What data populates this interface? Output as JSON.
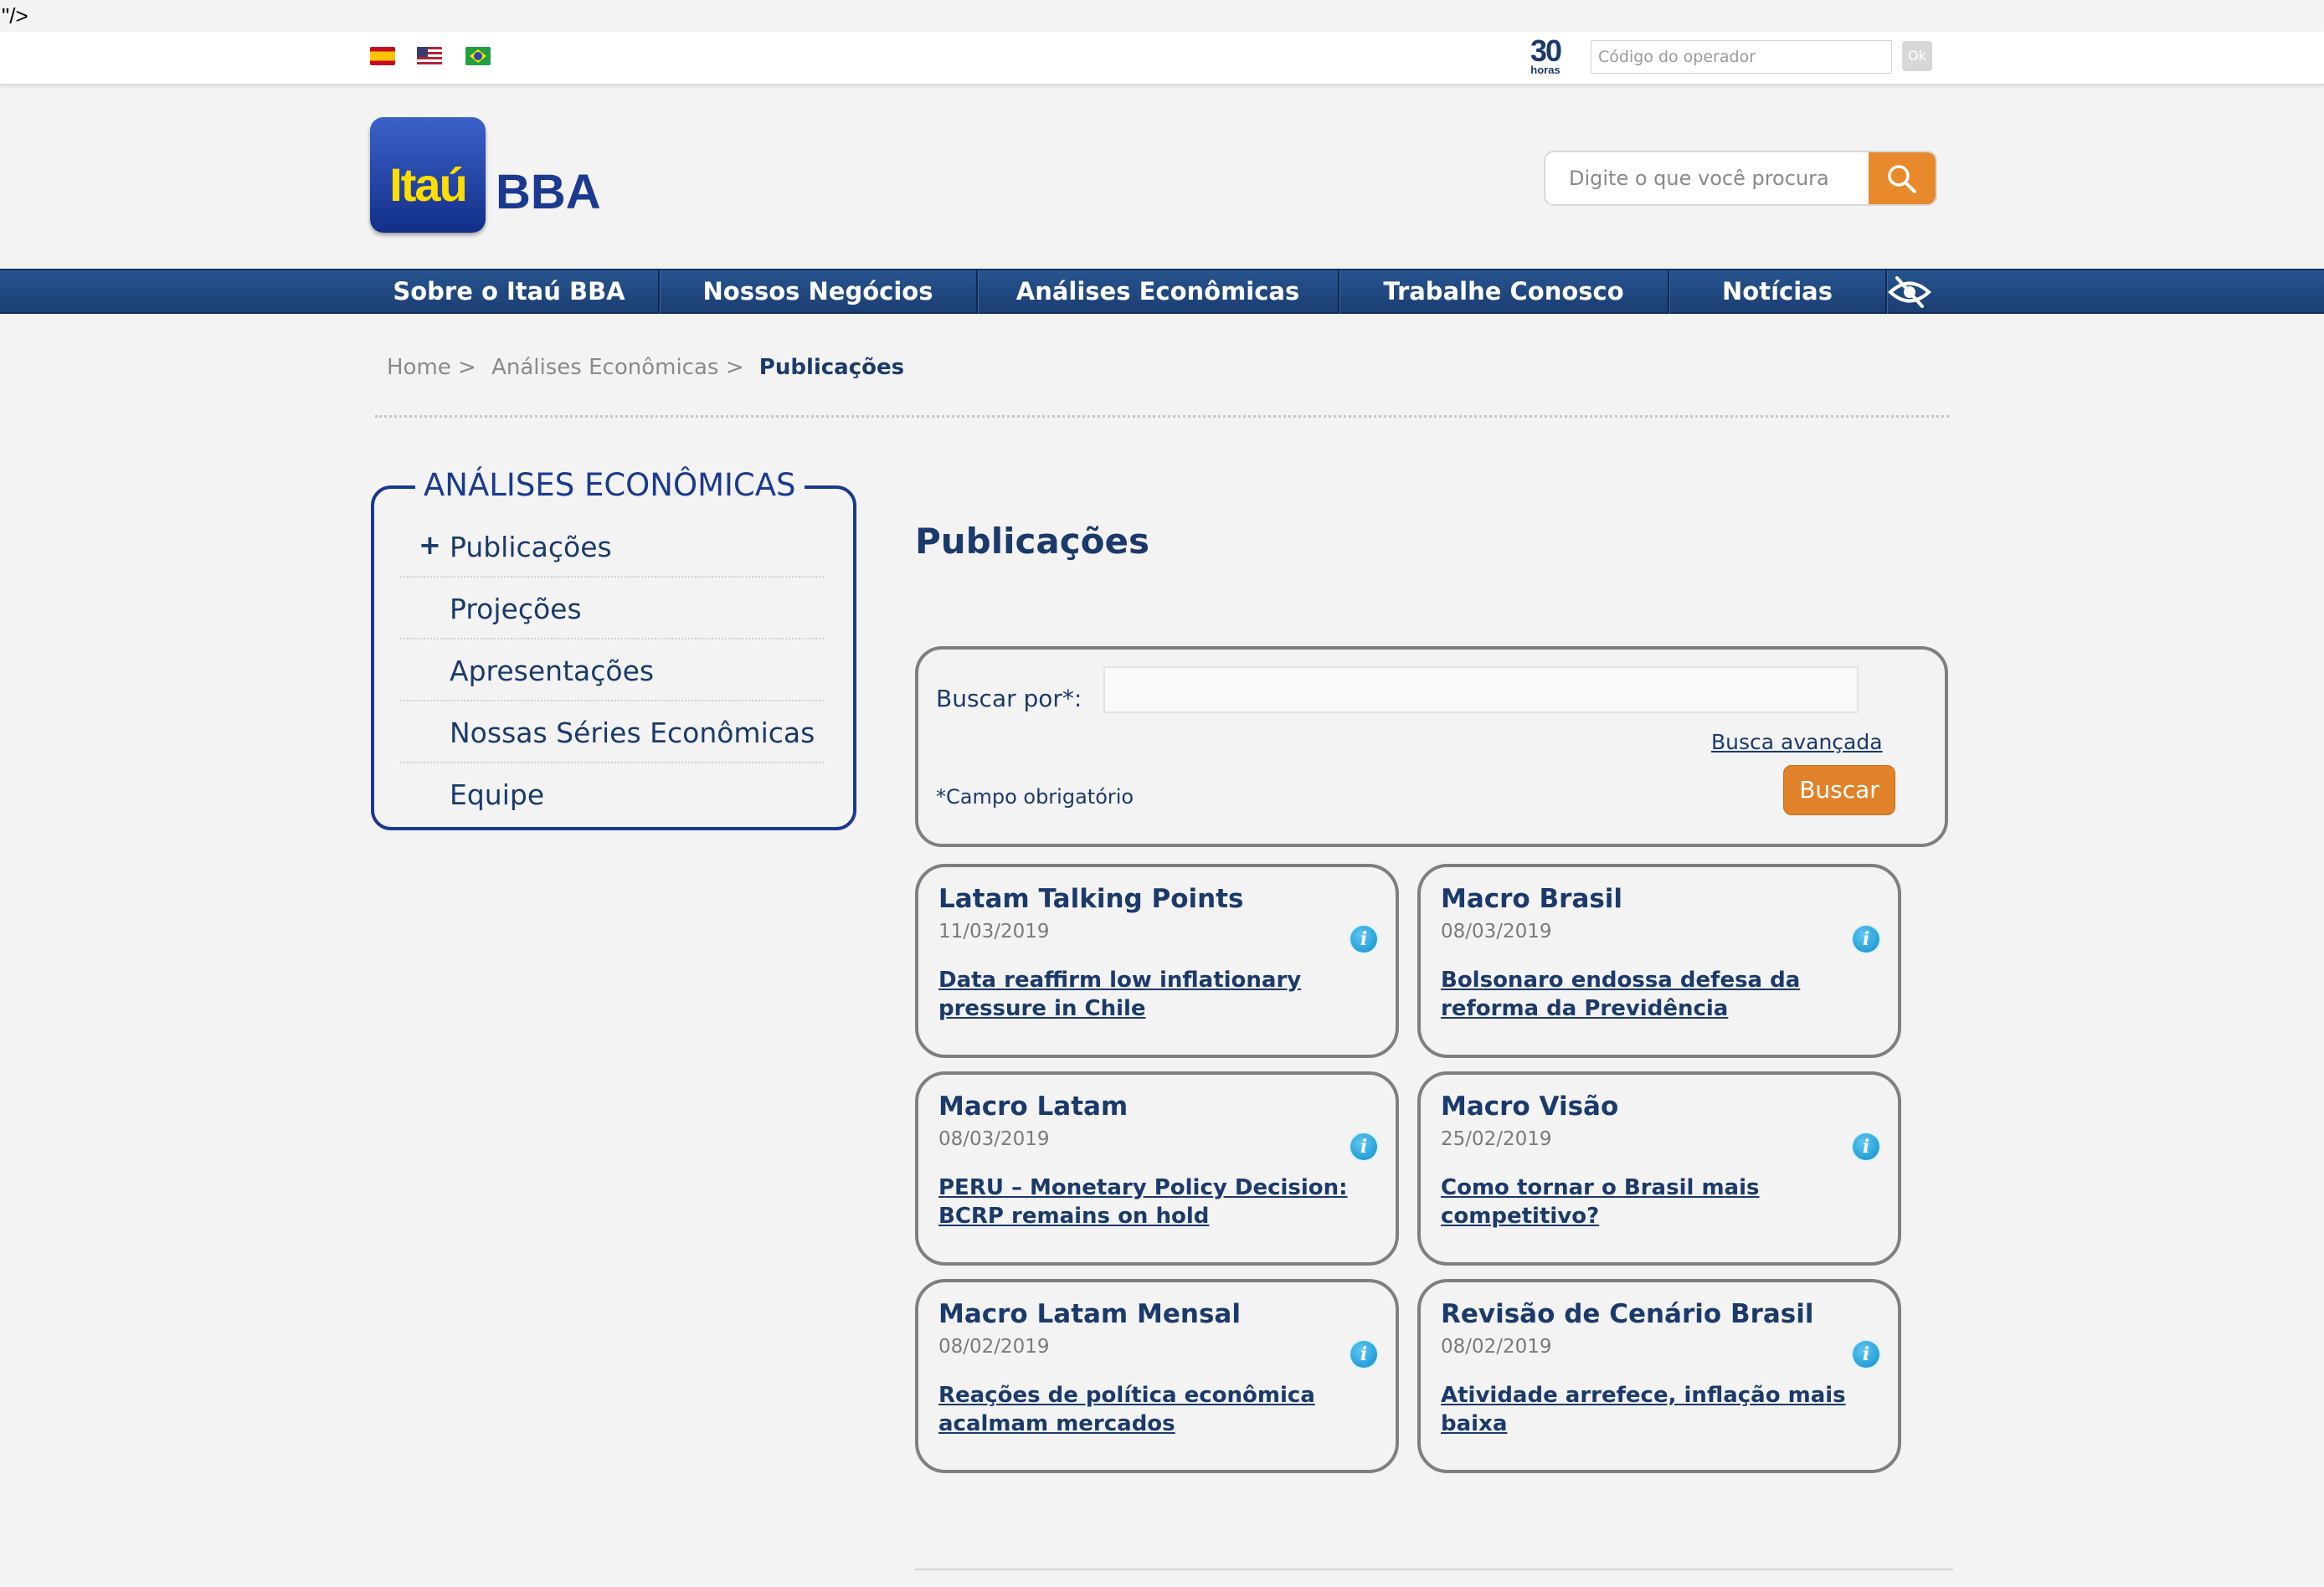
{
  "stray_text": "\"/>",
  "topbar": {
    "flags": [
      "es",
      "us",
      "br"
    ],
    "logo30_number": "30",
    "logo30_label": "horas",
    "operator_placeholder": "Código do operador",
    "ok_label": "Ok"
  },
  "header": {
    "logo_text": "Itaú",
    "logo_suffix": "BBA",
    "search_placeholder": "Digite o que você procura",
    "search_icon": "magnifier-icon"
  },
  "nav": {
    "items": [
      {
        "label": "Sobre o Itaú BBA"
      },
      {
        "label": "Nossos Negócios"
      },
      {
        "label": "Análises Econômicas"
      },
      {
        "label": "Trabalhe Conosco"
      },
      {
        "label": "Notícias"
      }
    ],
    "accessibility_icon": "eye-icon"
  },
  "breadcrumb": {
    "home": "Home >",
    "section": "Análises Econômicas >",
    "current": "Publicações"
  },
  "sidebar": {
    "title": "ANÁLISES ECONÔMICAS",
    "items": [
      {
        "label": "Publicações",
        "marker": "+"
      },
      {
        "label": "Projeções"
      },
      {
        "label": "Apresentações"
      },
      {
        "label": "Nossas Séries Econômicas"
      },
      {
        "label": "Equipe"
      }
    ]
  },
  "main": {
    "title": "Publicações",
    "search": {
      "label": "Buscar por*:",
      "value": "",
      "advanced_link": "Busca avançada",
      "required_note": "*Campo obrigatório",
      "button": "Buscar"
    },
    "cards": [
      {
        "title": "Latam Talking Points",
        "date": "11/03/2019",
        "link": "Data reaffirm low inflationary pressure in Chile",
        "icon": "info-icon"
      },
      {
        "title": "Macro Brasil",
        "date": "08/03/2019",
        "link": "Bolsonaro endossa defesa da reforma da Previdência",
        "icon": "info-icon"
      },
      {
        "title": "Macro Latam",
        "date": "08/03/2019",
        "link": "PERU – Monetary Policy Decision: BCRP remains on hold",
        "icon": "info-icon"
      },
      {
        "title": "Macro Visão",
        "date": "25/02/2019",
        "link": "Como tornar o Brasil mais competitivo?",
        "icon": "info-icon"
      },
      {
        "title": "Macro Latam Mensal",
        "date": "08/02/2019",
        "link": "Reações de política econômica acalmam mercados",
        "icon": "info-icon"
      },
      {
        "title": "Revisão de Cenário Brasil",
        "date": "08/02/2019",
        "link": "Atividade arrefece, inflação mais baixa",
        "icon": "info-icon"
      }
    ]
  },
  "colors": {
    "brand_blue": "#1b3a6b",
    "nav_blue": "#1f4680",
    "accent_orange": "#e0822a",
    "logo_yellow": "#ffdd00"
  }
}
